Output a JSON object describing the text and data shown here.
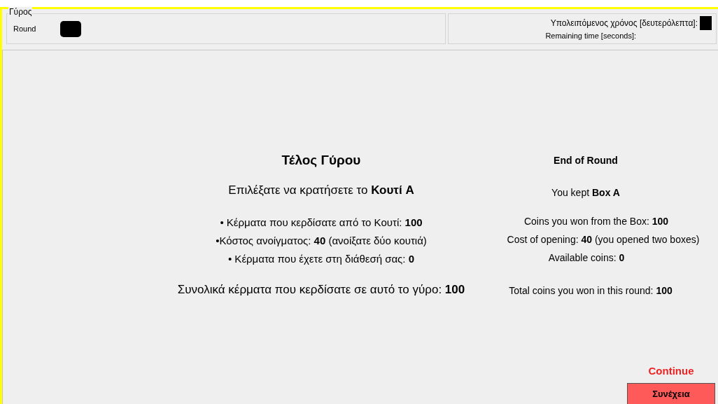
{
  "round_group": {
    "title": "Γύρος",
    "label": "Round"
  },
  "timer": {
    "label_greek": "Υπολειπόμενος χρόνος [δευτερόλεπτα]:",
    "label_english": "Remaining time [seconds]:"
  },
  "greek": {
    "title": "Τέλος Γύρου",
    "choice": "Επιλέξατε να κρατήσετε το **Κουτί A**",
    "details": [
      "• Κέρματα που κερδίσατε από το Κουτί: **100**",
      "•Κόστος ανοίγματος: **40** (ανοίξατε δύο κουτιά)",
      "• Κέρματα που έχετε στη διάθεσή σας: **0**"
    ],
    "total": "Συνολικά κέρματα που κερδίσατε σε αυτό το γύρο: **100**"
  },
  "english": {
    "title": "End of Round",
    "choice": "You kept **Box A**",
    "details": [
      "Coins you won from the Box:  **100**",
      "Cost of opening: **40** (you opened two boxes)",
      "Available coins:  **0**"
    ],
    "total": "Total coins you won in this round:  **100**"
  },
  "continue_label": "Continue",
  "continue_button": "Συνέχεια"
}
